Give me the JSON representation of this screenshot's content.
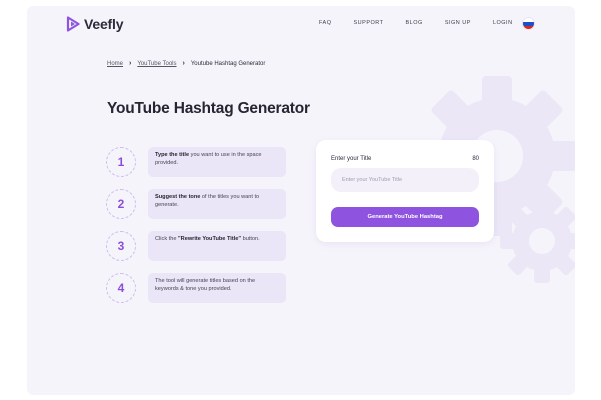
{
  "brand": {
    "name": "Veefly",
    "accent": "#8e54e0"
  },
  "nav": {
    "items": [
      "FAQ",
      "SUPPORT",
      "BLOG",
      "SIGN UP",
      "LOGIN"
    ],
    "language_flag": "russia-flag-icon"
  },
  "breadcrumb": {
    "home": "Home",
    "tools": "YouTube Tools",
    "current": "Youtube Hashtag Generator"
  },
  "page_title": "YouTube Hashtag Generator",
  "steps": [
    {
      "number": "1",
      "bold": "Type the title",
      "text_after": " you want to use in the space provided."
    },
    {
      "number": "2",
      "bold": "Suggest the tone",
      "text_after": " of the titles you want to generate."
    },
    {
      "number": "3",
      "text_before": "Click the ",
      "bold": "\"Rewrite YouTube Title\"",
      "text_after": " button."
    },
    {
      "number": "4",
      "text": "The tool will generate titles based on the keywords & tone you provided."
    }
  ],
  "form": {
    "label": "Enter your Title",
    "char_limit": "80",
    "input_value": "",
    "input_placeholder": "Enter your YouTube Title",
    "button_label": "Generate YouTube Hashtag"
  }
}
